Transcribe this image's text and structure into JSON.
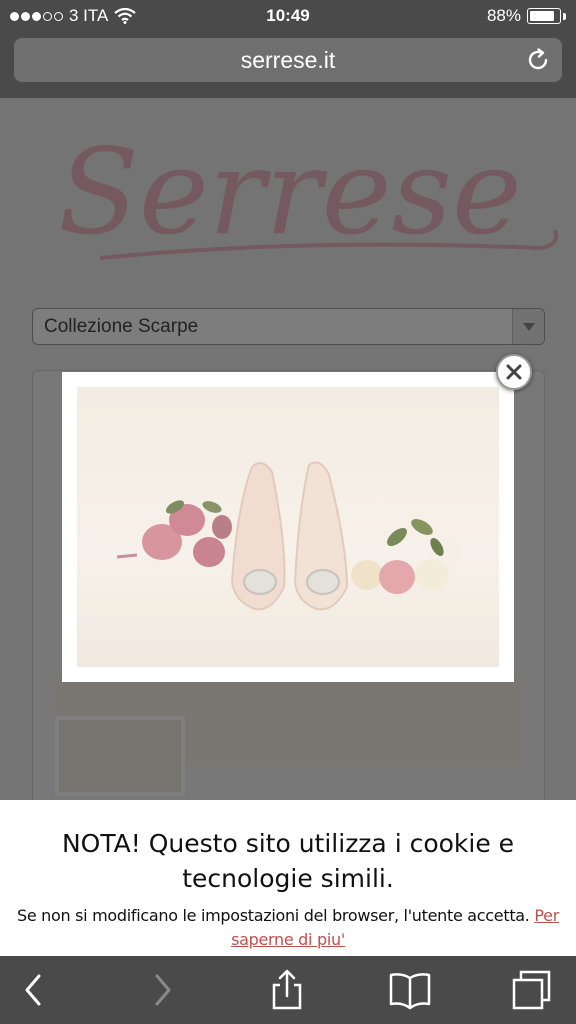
{
  "status_bar": {
    "carrier": "3 ITA",
    "time": "10:49",
    "battery_level": "88%",
    "battery_fraction": 0.88
  },
  "browser": {
    "url": "serrese.it"
  },
  "page": {
    "logo_text": "Serrese",
    "select_value": "Collezione Scarpe"
  },
  "cookie_banner": {
    "title": "NOTA! Questo sito utilizza i cookie e tecnologie simili.",
    "text": "Se non si modificano le impostazioni del browser, l'utente accetta.",
    "link_label": "Per saperne di piu'"
  },
  "colors": {
    "chrome_bg": "#4a4a4a",
    "link": "#c0504d",
    "logo": "#e8b4c0"
  },
  "icons": {
    "signal": "signal-dots-icon",
    "wifi": "wifi-icon",
    "battery": "battery-icon",
    "reload": "reload-icon",
    "close": "close-icon",
    "back": "chevron-left-icon",
    "forward": "chevron-right-icon",
    "share": "share-icon",
    "bookmarks": "book-icon",
    "tabs": "tabs-icon"
  }
}
